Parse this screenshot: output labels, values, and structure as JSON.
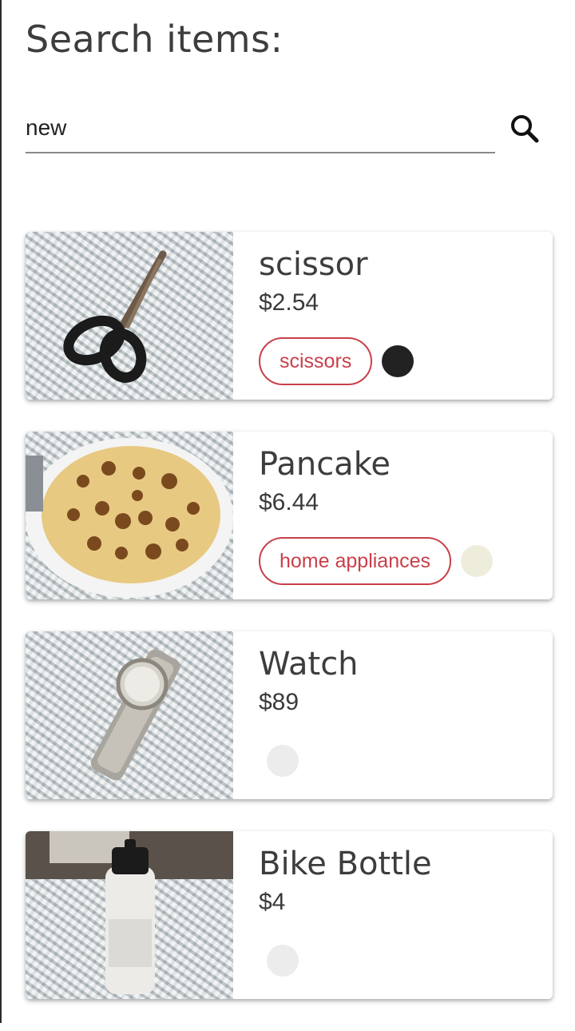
{
  "page": {
    "title": "Search items:"
  },
  "search": {
    "value": "new",
    "icon": "search-icon"
  },
  "items": [
    {
      "name": "scissor",
      "price": "$2.54",
      "tag": "scissors",
      "color": "#222222",
      "image": "scissors"
    },
    {
      "name": "Pancake",
      "price": "$6.44",
      "tag": "home appliances",
      "color": "#eeeddc",
      "image": "pancake"
    },
    {
      "name": "Watch",
      "price": "$89",
      "tag": "",
      "color": "#ececec",
      "image": "watch"
    },
    {
      "name": "Bike Bottle",
      "price": "$4",
      "tag": "",
      "color": "#ececec",
      "image": "bottle"
    }
  ],
  "colors": {
    "accent": "#c9404a",
    "text": "#3d3d3d"
  }
}
